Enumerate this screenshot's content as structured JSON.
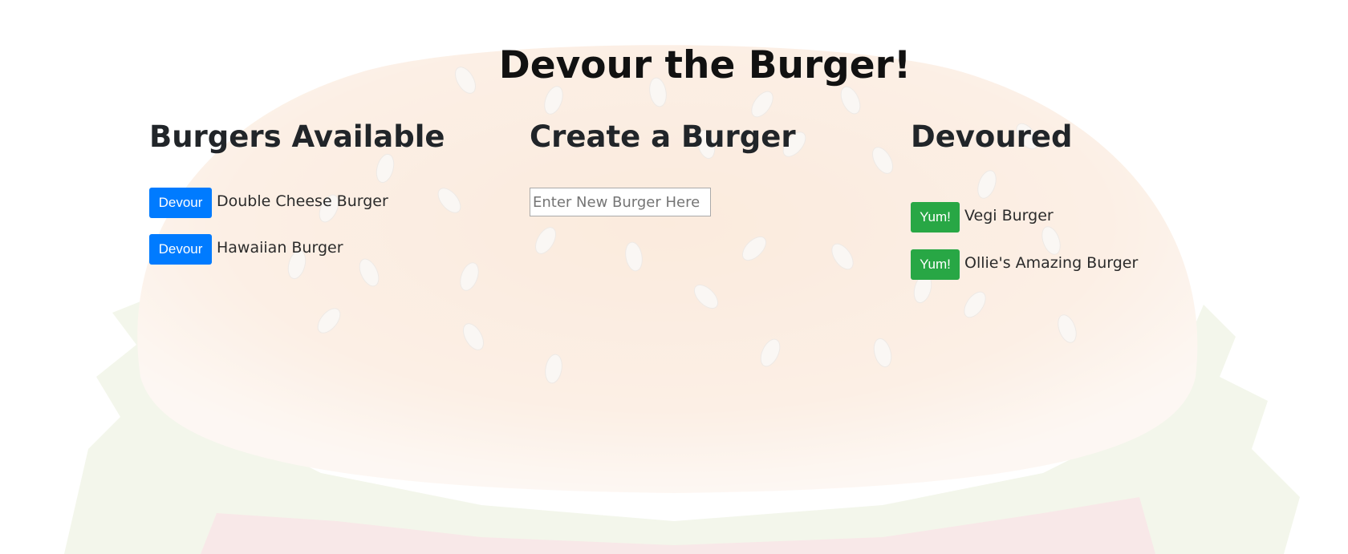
{
  "page": {
    "title": "Devour the Burger!"
  },
  "available": {
    "heading": "Burgers Available",
    "button_label": "Devour",
    "items": [
      {
        "name": "Double Cheese Burger"
      },
      {
        "name": "Hawaiian Burger"
      }
    ]
  },
  "create": {
    "heading": "Create a Burger",
    "input_placeholder": "Enter New Burger Here",
    "input_value": ""
  },
  "devoured": {
    "heading": "Devoured",
    "button_label": "Yum!",
    "items": [
      {
        "name": "Vegi Burger"
      },
      {
        "name": "Ollie's Amazing Burger"
      }
    ]
  },
  "colors": {
    "devour_button": "#007bff",
    "yum_button": "#28a745",
    "text": "#212529"
  }
}
